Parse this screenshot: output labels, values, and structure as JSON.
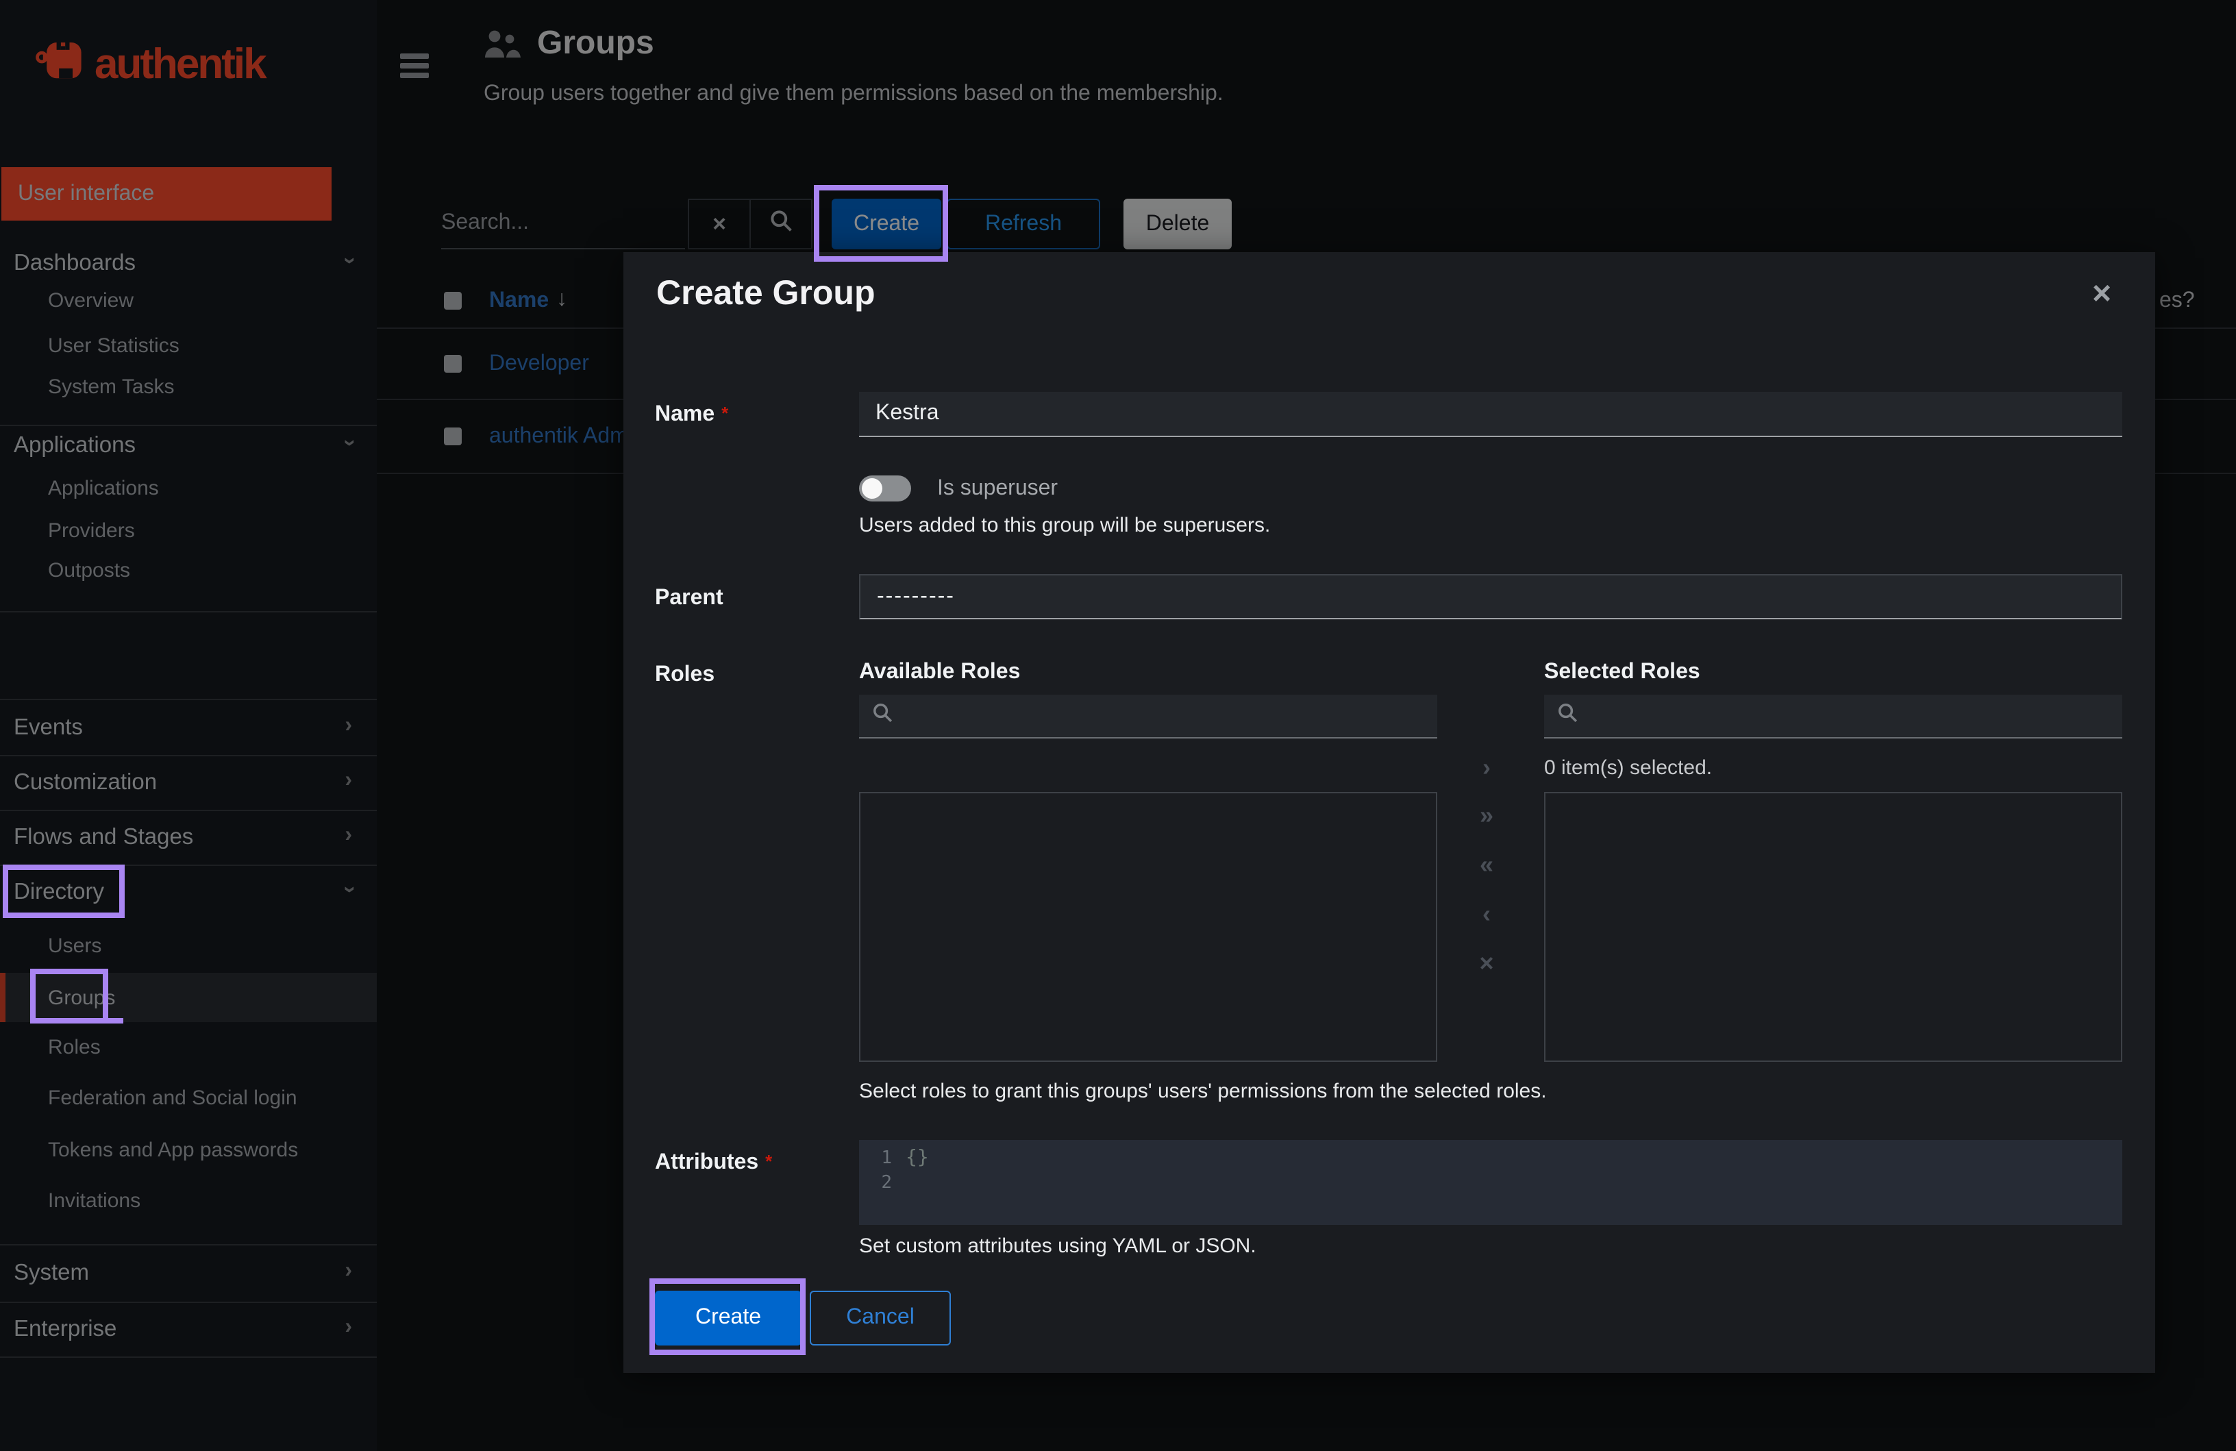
{
  "colors": {
    "accent_red": "#fd4b2d",
    "primary_blue": "#0066cc",
    "link_blue": "#3275c4",
    "annotation_purple": "#a985f2",
    "danger_red": "#c9190b"
  },
  "icons": {
    "chevron_right": "›",
    "sort_down": "↓",
    "close": "×",
    "clear": "×",
    "move_right": "›",
    "move_all_right": "»",
    "move_all_left": "«",
    "move_left": "‹",
    "remove": "×"
  },
  "sidebar": {
    "logo": "authentik",
    "user_interface": "User interface",
    "dashboards": "Dashboards",
    "overview": "Overview",
    "user_statistics": "User Statistics",
    "system_tasks": "System Tasks",
    "applications_section": "Applications",
    "applications": "Applications",
    "providers": "Providers",
    "outposts": "Outposts",
    "events": "Events",
    "customization": "Customization",
    "flows": "Flows and Stages",
    "directory": "Directory",
    "users": "Users",
    "groups": "Groups",
    "roles": "Roles",
    "federation": "Federation and Social login",
    "tokens": "Tokens and App passwords",
    "invitations": "Invitations",
    "system": "System",
    "enterprise": "Enterprise"
  },
  "header": {
    "title": "Groups",
    "subtitle": "Group users together and give them permissions based on the membership."
  },
  "toolbar": {
    "search_placeholder": "Search...",
    "create": "Create",
    "refresh": "Refresh",
    "delete": "Delete"
  },
  "table": {
    "name_header": "Name",
    "row1": "Developer",
    "row2": "authentik Admins",
    "clipped_header": "es?"
  },
  "modal": {
    "title": "Create Group",
    "required_mark": "*",
    "name_label": "Name",
    "name_value": "Kestra",
    "is_superuser": "Is superuser",
    "superuser_help": "Users added to this group will be superusers.",
    "parent_label": "Parent",
    "parent_value": "---------",
    "roles_label": "Roles",
    "available_roles": "Available Roles",
    "selected_roles": "Selected Roles",
    "items_selected": "0 item(s) selected.",
    "roles_help": "Select roles to grant this groups' users' permissions from the selected roles.",
    "attributes_label": "Attributes",
    "editor_line1": "1",
    "editor_line2": "2",
    "editor_content": "{}",
    "attributes_help": "Set custom attributes using YAML or JSON.",
    "create": "Create",
    "cancel": "Cancel"
  }
}
